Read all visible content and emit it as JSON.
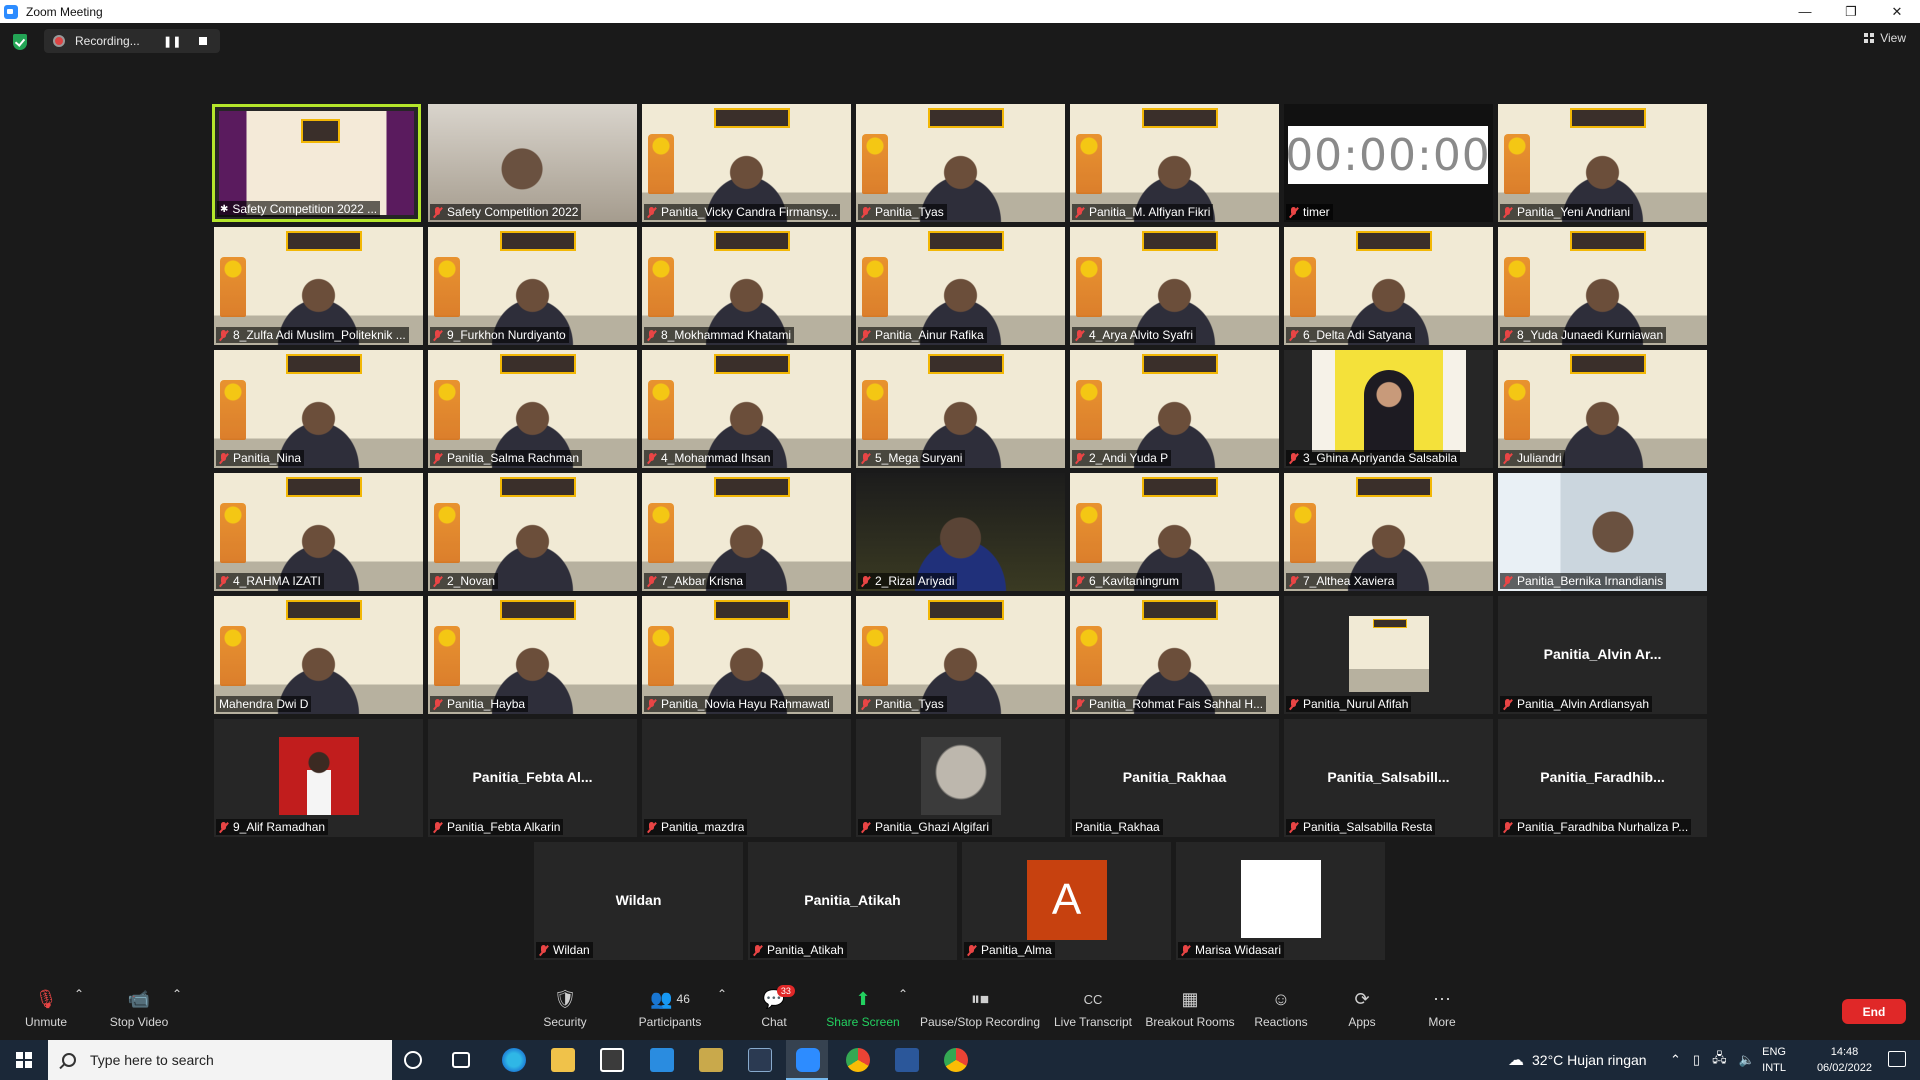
{
  "window": {
    "title": "Zoom Meeting",
    "minimize": "—",
    "restore": "❐",
    "close": "✕"
  },
  "top": {
    "recording_label": "Recording...",
    "pause_glyph": "❚❚",
    "view_label": "View"
  },
  "tiles": [
    {
      "label": "Safety Competition 2022 ..."
    },
    {
      "label": "Safety Competition 2022"
    },
    {
      "label": "Panitia_Vicky Candra Firmansy..."
    },
    {
      "label": "Panitia_Tyas"
    },
    {
      "label": "Panitia_M. Alfiyan Fikri"
    },
    {
      "label": "timer",
      "timer": "00:00:00"
    },
    {
      "label": "Panitia_Yeni Andriani"
    },
    {
      "label": "8_Zulfa Adi Muslim_Politeknik ..."
    },
    {
      "label": "9_Furkhon Nurdiyanto"
    },
    {
      "label": "8_Mokhammad Khatami"
    },
    {
      "label": "Panitia_Ainur Rafika"
    },
    {
      "label": "4_Arya Alvito Syafri"
    },
    {
      "label": "6_Delta Adi Satyana"
    },
    {
      "label": "8_Yuda Junaedi Kurniawan"
    },
    {
      "label": "Panitia_Nina"
    },
    {
      "label": "Panitia_Salma Rachman"
    },
    {
      "label": "4_Mohammad Ihsan"
    },
    {
      "label": "5_Mega Suryani"
    },
    {
      "label": "2_Andi Yuda P"
    },
    {
      "label": "3_Ghina Apriyanda Salsabila"
    },
    {
      "label": "Juliandri"
    },
    {
      "label": "4_RAHMA IZATI"
    },
    {
      "label": "2_Novan"
    },
    {
      "label": "7_Akbar Krisna"
    },
    {
      "label": "2_Rizal Ariyadi"
    },
    {
      "label": "6_Kavitaningrum"
    },
    {
      "label": "7_Althea Xaviera"
    },
    {
      "label": "Panitia_Bernika Irnandianis"
    },
    {
      "label": "Mahendra Dwi D"
    },
    {
      "label": "Panitia_Hayba"
    },
    {
      "label": "Panitia_Novia Hayu Rahmawati"
    },
    {
      "label": "Panitia_Tyas"
    },
    {
      "label": "Panitia_Rohmat Fais Sahhal H..."
    },
    {
      "label": "Panitia_Nurul Afifah"
    },
    {
      "label": "Panitia_Alvin Ardiansyah",
      "display": "Panitia_Alvin  Ar..."
    },
    {
      "label": "9_Alif Ramadhan"
    },
    {
      "label": "Panitia_Febta Alkarin",
      "display": "Panitia_Febta  Al..."
    },
    {
      "label": "Panitia_mazdra"
    },
    {
      "label": "Panitia_Ghazi Algifari"
    },
    {
      "label": "Panitia_Rakhaa",
      "display": "Panitia_Rakhaa"
    },
    {
      "label": "Panitia_Salsabilla Resta",
      "display": "Panitia_Salsabill..."
    },
    {
      "label": "Panitia_Faradhiba Nurhaliza P...",
      "display": "Panitia_Faradhib..."
    },
    {
      "label": "Wildan",
      "display": "Wildan"
    },
    {
      "label": "Panitia_Atikah",
      "display": "Panitia_Atikah"
    },
    {
      "label": "Panitia_Alma",
      "letter": "A"
    },
    {
      "label": "Marisa Widasari"
    }
  ],
  "controls": {
    "unmute": "Unmute",
    "stop_video": "Stop Video",
    "security": "Security",
    "participants": "Participants",
    "participants_count": "46",
    "chat": "Chat",
    "chat_badge": "33",
    "share_screen": "Share Screen",
    "pause_stop_recording": "Pause/Stop Recording",
    "live_transcript": "Live Transcript",
    "breakout_rooms": "Breakout Rooms",
    "reactions": "Reactions",
    "apps": "Apps",
    "more": "More",
    "end": "End"
  },
  "taskbar": {
    "search_placeholder": "Type here to search",
    "weather": "32°C  Hujan ringan",
    "lang_top": "ENG",
    "lang_bottom": "INTL",
    "time": "14:48",
    "date": "06/02/2022"
  },
  "colors": {
    "accent_green": "#23d160",
    "end_red": "#e02828",
    "active_border": "#b5e62b"
  }
}
